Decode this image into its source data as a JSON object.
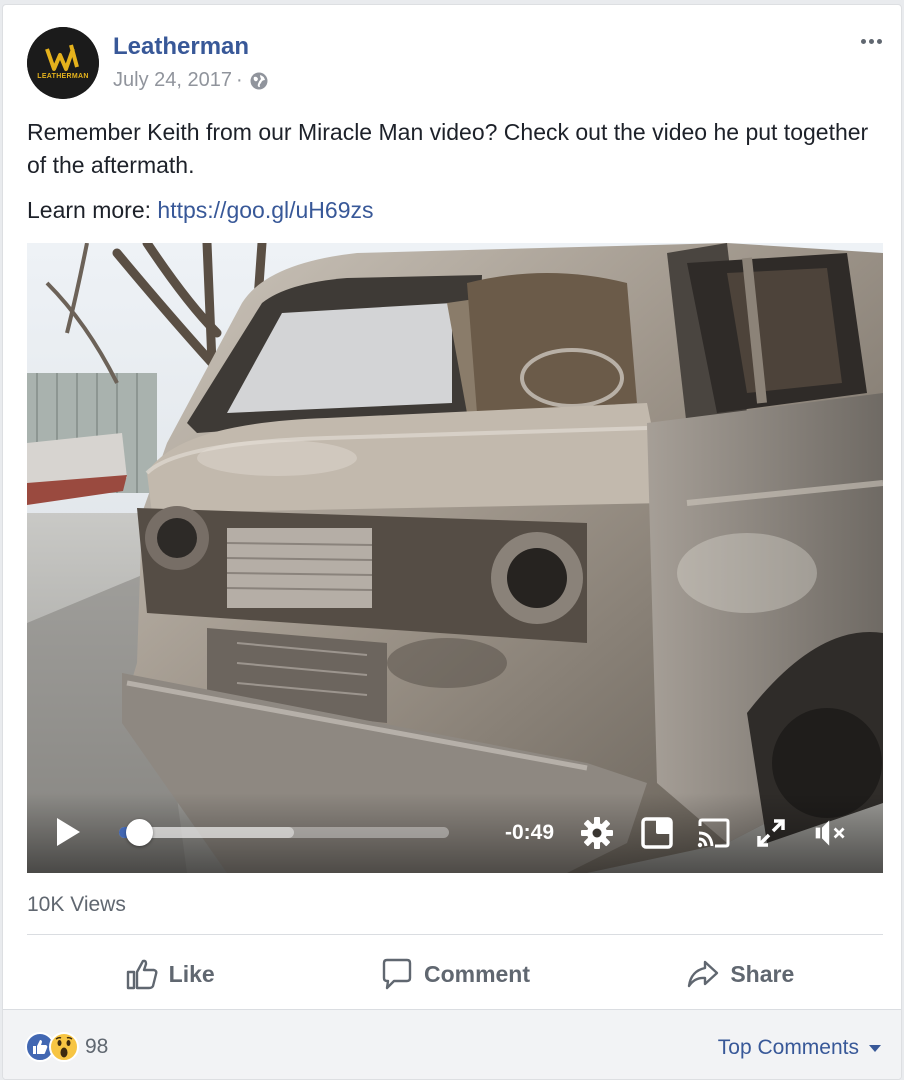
{
  "post": {
    "page_name": "Leatherman",
    "avatar_text": "LEATHERMAN",
    "date": "July 24, 2017",
    "separator": "·",
    "privacy_icon": "globe-icon",
    "more_icon": "more-dots-icon",
    "text": "Remember Keith from our Miracle Man video? Check out the video he put together of the aftermath.",
    "learn_more_prefix": "Learn more:",
    "learn_more_link": "https://goo.gl/uH69zs"
  },
  "video": {
    "time_remaining": "-0:49",
    "progress_played_fraction": 0.06,
    "progress_buffered_fraction": 0.53,
    "muted": true,
    "controls": [
      "play-icon",
      "settings-gear-icon",
      "picture-in-picture-icon",
      "cast-icon",
      "fullscreen-icon",
      "mute-icon"
    ]
  },
  "stats": {
    "views": "10K Views"
  },
  "actions": {
    "like": "Like",
    "comment": "Comment",
    "share": "Share"
  },
  "footer": {
    "reaction_count": "98",
    "reaction_icons": [
      "like-reaction-icon",
      "wow-reaction-icon"
    ],
    "top_comments": "Top Comments"
  },
  "colors": {
    "link": "#385898",
    "like_blue": "#4267b2",
    "wow_yellow": "#f7c543"
  }
}
